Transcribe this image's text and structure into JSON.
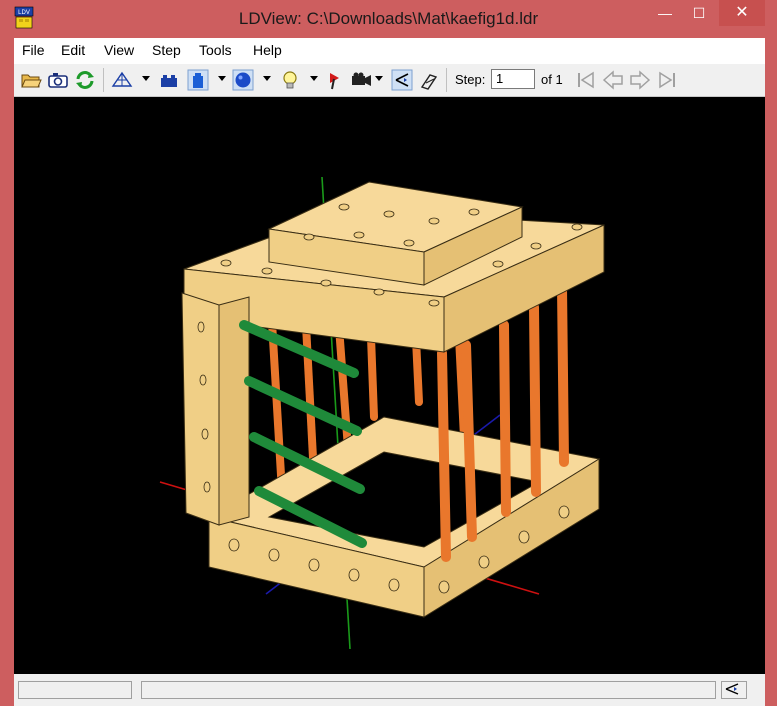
{
  "window": {
    "title": "LDView: C:\\Downloads\\Mat\\kaefig1d.ldr",
    "app_icon": "ldview-app-icon",
    "controls": {
      "minimize": "—",
      "maximize": "☐",
      "close": "✕"
    }
  },
  "menu": {
    "items": [
      {
        "label": "File"
      },
      {
        "label": "Edit"
      },
      {
        "label": "View"
      },
      {
        "label": "Step"
      },
      {
        "label": "Tools"
      },
      {
        "label": "Help"
      }
    ]
  },
  "toolbar": {
    "icons": [
      "open-folder-icon",
      "screenshot-camera-icon",
      "reload-icon",
      "wireframe-icon",
      "lego-brick-icon",
      "blue-brick-icon",
      "blue-sphere-icon",
      "lightbulb-icon",
      "bfc-icon",
      "camera-view-icon",
      "axes-icon",
      "edges-icon"
    ],
    "step_label": "Step:",
    "step_value": "1",
    "step_of": "of 1",
    "nav_icons": [
      "first-step-icon",
      "previous-step-icon",
      "next-step-icon",
      "last-step-icon"
    ]
  },
  "viewport": {
    "background": "#000000",
    "model_description_colors": {
      "brick": "#f7d99a",
      "bar_orange": "#e9772c",
      "bar_green": "#1f8a3a",
      "axis_x": "#cc1010",
      "axis_y": "#1a9a1a",
      "axis_z": "#1a1aaa"
    }
  },
  "statusbar": {
    "latlong_icon": "latlong-rotation-icon"
  }
}
